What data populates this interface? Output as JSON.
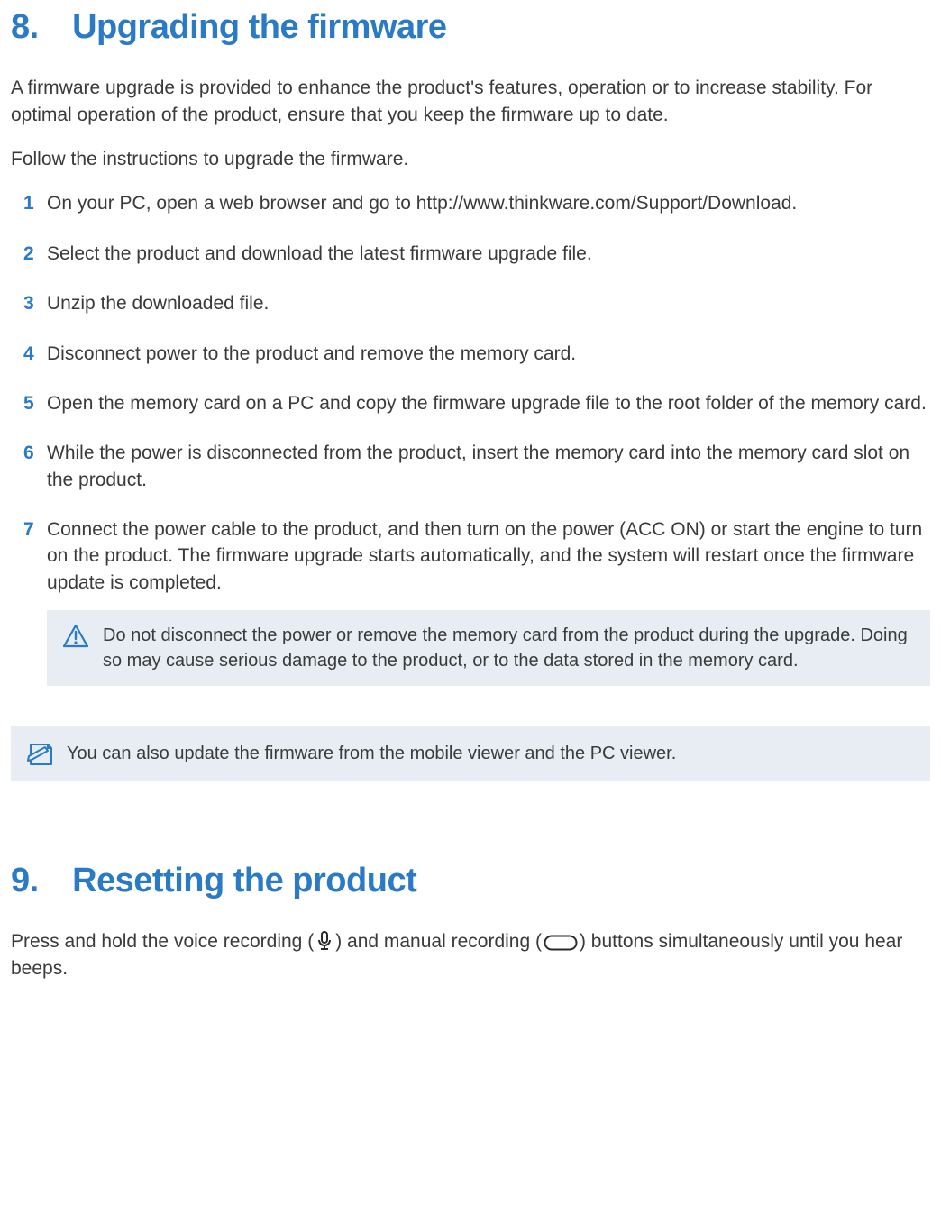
{
  "section8": {
    "number": "8.",
    "title": "Upgrading the firmware",
    "intro1": "A firmware upgrade is provided to enhance the product's features, operation or to increase stability. For optimal operation of the product, ensure that you keep the firmware up to date.",
    "intro2": "Follow the instructions to upgrade the firmware.",
    "steps": [
      {
        "n": "1",
        "t": "On your PC, open a web browser and go to http://www.thinkware.com/Support/Download."
      },
      {
        "n": "2",
        "t": "Select the product and download the latest firmware upgrade file."
      },
      {
        "n": "3",
        "t": "Unzip the downloaded file."
      },
      {
        "n": "4",
        "t": "Disconnect power to the product and remove the memory card."
      },
      {
        "n": "5",
        "t": "Open the memory card on a PC and copy the firmware upgrade file to the root folder of the memory card."
      },
      {
        "n": "6",
        "t": "While the power is disconnected from the product, insert the memory card into the memory card slot on the product."
      },
      {
        "n": "7",
        "t": "Connect the power cable to the product, and then turn on the power (ACC ON) or start the engine to turn on the product. The firmware upgrade starts automatically, and the system will restart once the firmware update is completed."
      }
    ],
    "warning": "Do not disconnect the power or remove the memory card from the product during the upgrade. Doing so may cause serious damage to the product, or to the data stored in the memory card.",
    "note": "You can also update the firmware from the mobile viewer and the PC viewer."
  },
  "section9": {
    "number": "9.",
    "title": "Resetting the product",
    "body_pre": "Press and hold the voice recording (",
    "body_mid": ") and manual recording (",
    "body_post": ") buttons simultaneously until you hear beeps."
  }
}
